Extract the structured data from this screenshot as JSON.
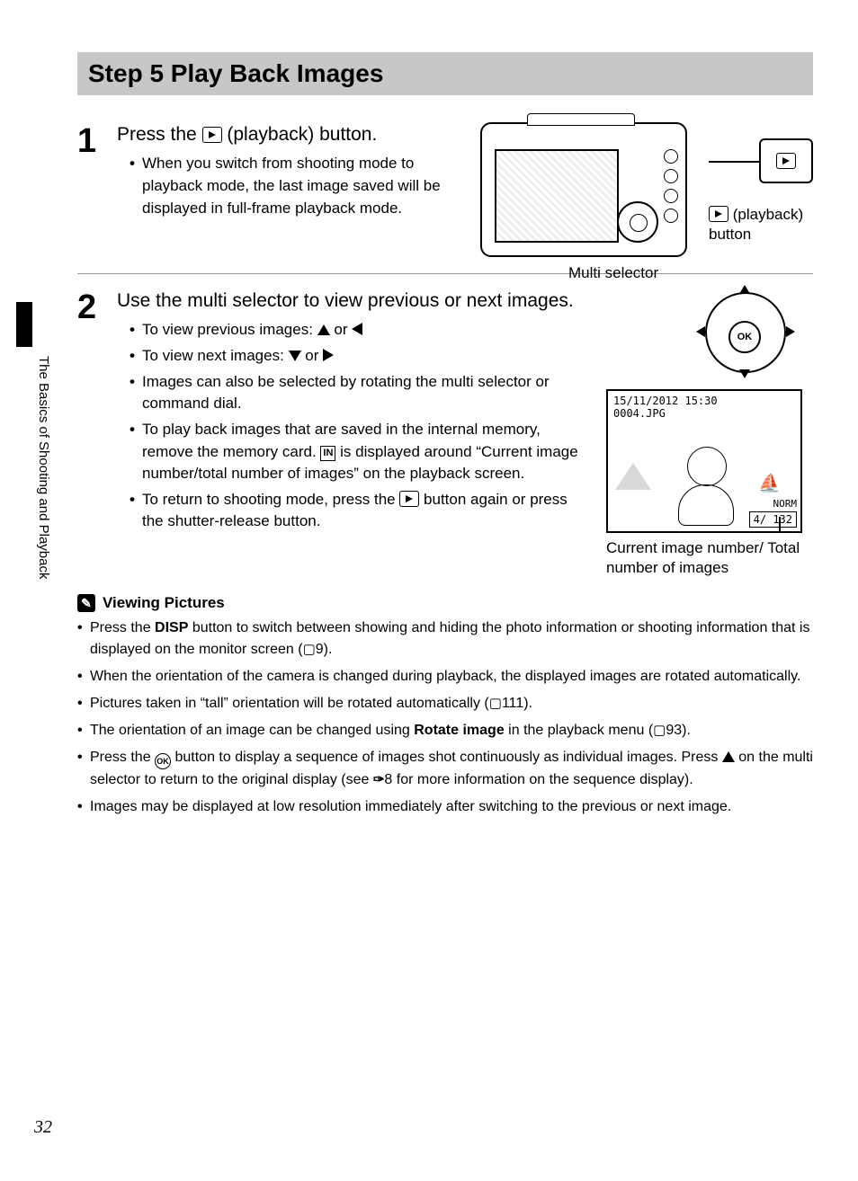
{
  "title": "Step 5 Play Back Images",
  "side_tab": "The Basics of Shooting and Playback",
  "page_number": "32",
  "step1": {
    "num": "1",
    "heading_a": "Press the ",
    "heading_b": " (playback) button.",
    "bullet1": "When you switch from shooting mode to playback mode, the last image saved will be displayed in full-frame playback mode.",
    "fig_callout_top_a": " (playback)",
    "fig_callout_top_b": "button",
    "fig_multi": "Multi selector"
  },
  "step2": {
    "num": "2",
    "heading": "Use the multi selector to view previous or next images.",
    "b1": "To view previous images: ",
    "b1_or": " or ",
    "b2": "To view next images: ",
    "b2_or": " or ",
    "b3": "Images can also be selected by rotating the multi selector or command dial.",
    "b4a": "To play back images that are saved in the internal memory, remove the memory card. ",
    "b4b": " is displayed around “Current image number/total number of images” on the playback screen.",
    "b5a": "To return to shooting mode, press the ",
    "b5b": " button again or press the shutter-release button.",
    "ok_label": "OK",
    "pb_date": "15/11/2012 15:30",
    "pb_file": "0004.JPG",
    "pb_norm": "NORM",
    "pb_count": "4/ 132",
    "pb_caption": "Current image number/ Total number of images"
  },
  "notes": {
    "heading": "Viewing Pictures",
    "n1a": "Press the ",
    "n1_disp": "DISP",
    "n1b": " button to switch between showing and hiding the photo information or shooting information that is displayed on the monitor screen (",
    "n1_ref": "9).",
    "n2": "When the orientation of the camera is changed during playback, the displayed images are rotated automatically.",
    "n3a": "Pictures taken in “tall” orientation will be rotated automatically (",
    "n3_ref": "111).",
    "n4a": "The orientation of an image can be changed using ",
    "n4_bold": "Rotate image",
    "n4b": " in the playback menu (",
    "n4_ref": "93).",
    "n5a": "Press the ",
    "n5b": " button to display a sequence of images shot continuously as individual images. Press ",
    "n5c": " on the multi selector to return to the original display (see ",
    "n5_ref": "8 for more information on the sequence display).",
    "n6": "Images may be displayed at low resolution immediately after switching to the previous or next image."
  }
}
